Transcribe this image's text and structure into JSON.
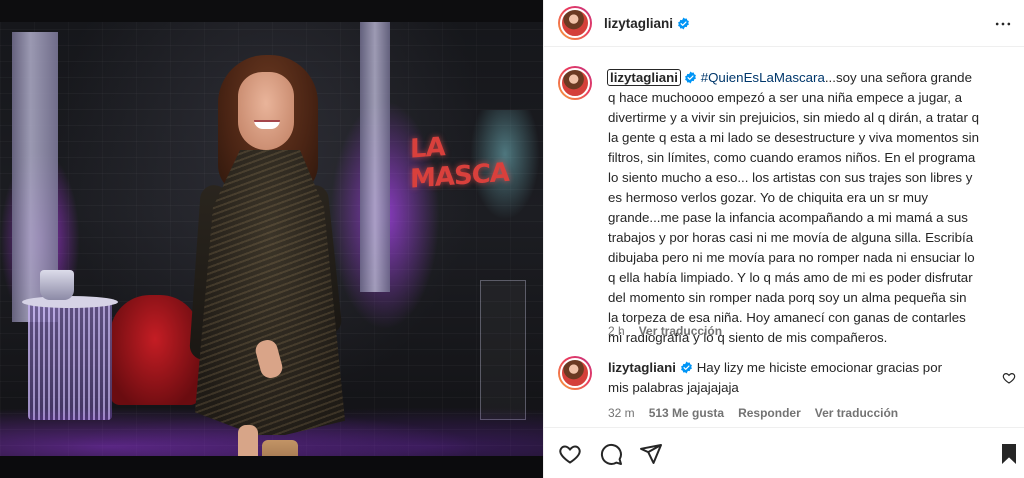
{
  "post": {
    "username": "lizytagliani",
    "more_icon": "more-horizontal-icon"
  },
  "caption": {
    "username": "lizytagliani",
    "hashtag": "#QuienEsLaMascara",
    "text": "...soy una señora grande q hace muchoooo empezó a ser una niña empece a jugar, a divertirme y a vivir sin prejuicios, sin miedo al q dirán, a tratar q la gente q esta a mi lado se desestructure y viva momentos sin filtros, sin límites, como cuando eramos niños. En el programa lo siento mucho a eso... los artistas con sus trajes son libres y es hermoso verlos gozar. Yo de chiquita era un sr muy grande...me pase la infancia acompañando a mi mamá a sus trabajos y por horas casi ni me movía de alguna silla. Escribía dibujaba pero ni me movía para no romper nada ni ensuciar lo q ella había limpiado. Y lo q más amo de mi es poder disfrutar del momento sin romper nada porq soy un alma pequeña sin la torpeza de esa niña. Hoy amanecí con ganas de contarles mi radiografía y lo q siento de mis compañeros.",
    "time": "2 h",
    "translate": "Ver traducción"
  },
  "reply": {
    "username": "lizytagliani",
    "text": "Hay lizy me hiciste emocionar gracias por mis palabras jajajajaja",
    "time": "32 m",
    "likes": "513 Me gusta",
    "reply_label": "Responder",
    "translate": "Ver traducción"
  },
  "photo": {
    "sign_text": "LA MASCA"
  },
  "actions": {
    "icons": [
      "heart-icon",
      "comment-icon",
      "share-icon",
      "bookmark-icon"
    ]
  },
  "colors": {
    "text": "#262626",
    "muted": "#737373",
    "link": "#00376b",
    "verified": "#0095f6"
  }
}
